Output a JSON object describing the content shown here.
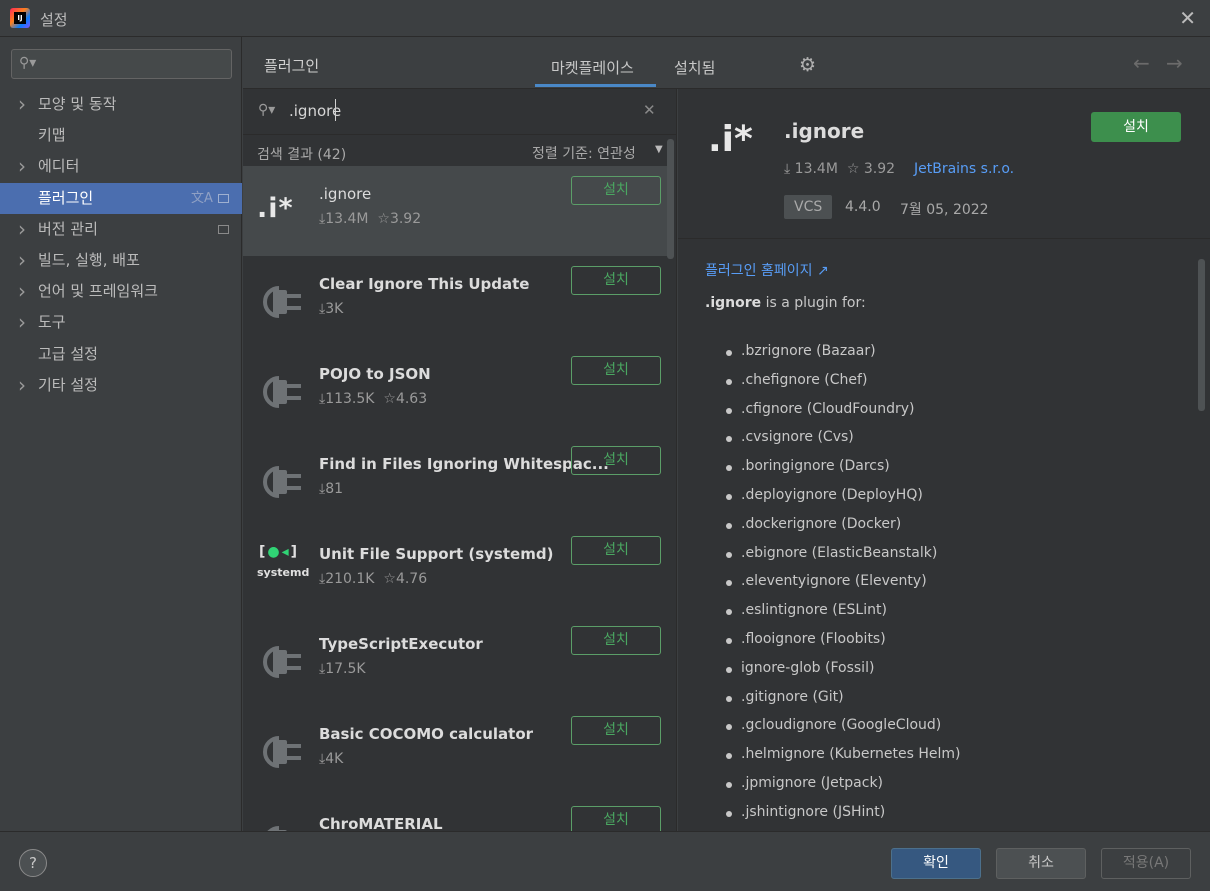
{
  "window": {
    "title": "설정",
    "app_icon_text": "IJ"
  },
  "sidebar": {
    "search_placeholder": "",
    "items": [
      {
        "label": "모양 및 동작",
        "expandable": true
      },
      {
        "label": "키맵",
        "expandable": false
      },
      {
        "label": "에디터",
        "expandable": true
      },
      {
        "label": "플러그인",
        "expandable": false,
        "selected": true
      },
      {
        "label": "버전 관리",
        "expandable": true
      },
      {
        "label": "빌드, 실행, 배포",
        "expandable": true
      },
      {
        "label": "언어 및 프레임워크",
        "expandable": true
      },
      {
        "label": "도구",
        "expandable": true
      },
      {
        "label": "고급 설정",
        "expandable": false
      },
      {
        "label": "기타 설정",
        "expandable": true
      }
    ]
  },
  "header": {
    "title": "플러그인",
    "tabs": [
      {
        "label": "마켓플레이스",
        "active": true
      },
      {
        "label": "설치됨",
        "active": false
      }
    ]
  },
  "list": {
    "search_value": ".ignore",
    "result_count": "검색 결과 (42)",
    "sort_label": "정렬 기준: 연관성",
    "install_label": "설치",
    "plugins": [
      {
        "name": ".ignore",
        "downloads": "13.4M",
        "rating": "3.92",
        "icon": "ignore-logo"
      },
      {
        "name": "Clear Ignore This Update",
        "downloads": "3K",
        "rating": "",
        "icon": "plugin-plug-icon"
      },
      {
        "name": "POJO to JSON",
        "downloads": "113.5K",
        "rating": "4.63",
        "icon": "plugin-plug-icon"
      },
      {
        "name": "Find in Files Ignoring Whitespac...",
        "downloads": "81",
        "rating": "",
        "icon": "plugin-plug-icon"
      },
      {
        "name": "Unit File Support (systemd)",
        "downloads": "210.1K",
        "rating": "4.76",
        "icon": "systemd-logo"
      },
      {
        "name": "TypeScriptExecutor",
        "downloads": "17.5K",
        "rating": "",
        "icon": "plugin-plug-icon"
      },
      {
        "name": "Basic COCOMO calculator",
        "downloads": "4K",
        "rating": "",
        "icon": "plugin-plug-icon"
      },
      {
        "name": "ChroMATERIAL",
        "downloads": "",
        "rating": "",
        "icon": "plugin-plug-icon"
      }
    ]
  },
  "detail": {
    "name": ".ignore",
    "install_label": "설치",
    "downloads": "13.4M",
    "rating": "3.92",
    "vendor": "JetBrains s.r.o.",
    "tag": "VCS",
    "version": "4.4.0",
    "date": "7월 05, 2022",
    "homepage_label": "플러그인 홈페이지 ↗",
    "desc_bold": ".ignore",
    "desc_rest": " is a plugin for:",
    "formats": [
      ".bzrignore (Bazaar)",
      ".chefignore (Chef)",
      ".cfignore (CloudFoundry)",
      ".cvsignore (Cvs)",
      ".boringignore (Darcs)",
      ".deployignore (DeployHQ)",
      ".dockerignore (Docker)",
      ".ebignore (ElasticBeanstalk)",
      ".eleventyignore (Eleventy)",
      ".eslintignore (ESLint)",
      ".flooignore (Floobits)",
      "ignore-glob (Fossil)",
      ".gitignore (Git)",
      ".gcloudignore (GoogleCloud)",
      ".helmignore (Kubernetes Helm)",
      ".jpmignore (Jetpack)",
      ".jshintignore (JSHint)"
    ]
  },
  "footer": {
    "help": "?",
    "ok": "확인",
    "cancel": "취소",
    "apply": "적용(A)"
  },
  "colors": {
    "accent": "#4b6eaf",
    "install_green": "#3d8f4d",
    "link": "#589df6"
  }
}
